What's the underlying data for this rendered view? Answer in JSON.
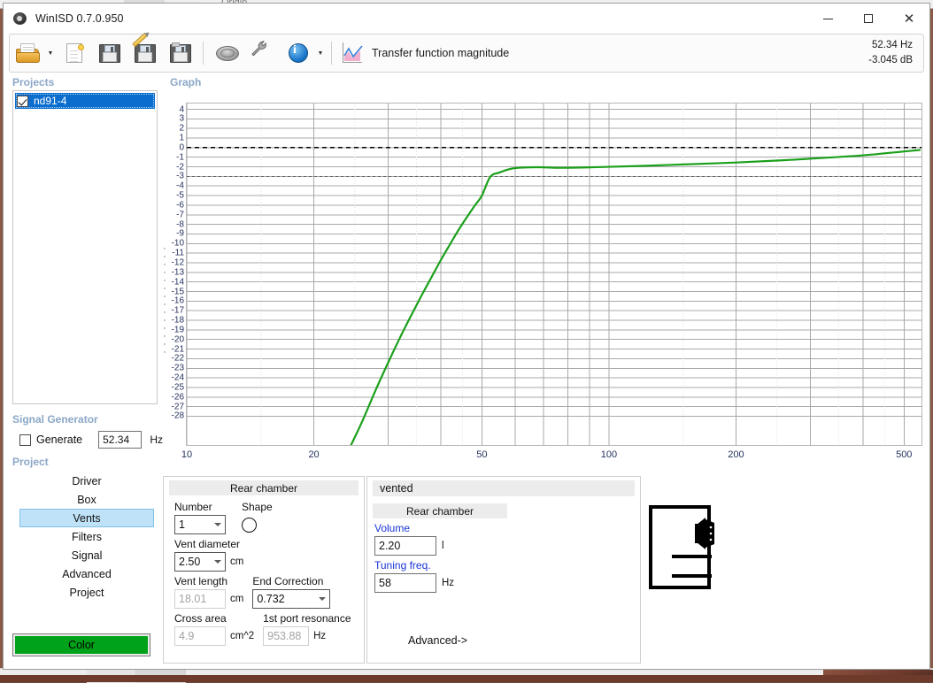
{
  "desktop": {
    "bg_window_label": "Origin"
  },
  "window": {
    "title": "WinISD 0.7.0.950",
    "icon": "speaker-icon",
    "minimize": "—",
    "maximize": "□",
    "close": "✕"
  },
  "toolbar": {
    "items": [
      {
        "name": "open-project-button",
        "icon": "open-folder-icon",
        "has_dropdown": true
      },
      {
        "name": "new-project-button",
        "icon": "new-document-icon",
        "has_dropdown": false
      },
      {
        "name": "save-button",
        "icon": "floppy-save-icon",
        "has_dropdown": false
      },
      {
        "name": "save-as-button",
        "icon": "floppy-pencil-icon",
        "has_dropdown": false
      },
      {
        "name": "save-all-button",
        "icon": "floppy-all-icon",
        "has_dropdown": false
      },
      {
        "name": "driver-database-button",
        "icon": "speaker-driver-icon",
        "has_dropdown": false
      },
      {
        "name": "tools-button",
        "icon": "wrench-icon",
        "has_dropdown": false
      },
      {
        "name": "info-button",
        "icon": "info-circle-icon",
        "has_dropdown": true
      }
    ],
    "graph_icon": "chart-curve-icon",
    "transfer_function_label": "Transfer function magnitude",
    "readout_frequency": "52.34 Hz",
    "readout_gain": "-3.045 dB"
  },
  "projects": {
    "caption": "Projects",
    "items": [
      {
        "label": "nd91-4",
        "checked": true,
        "selected": true
      }
    ]
  },
  "signal_generator": {
    "caption": "Signal Generator",
    "generate_label": "Generate",
    "generate_checked": false,
    "frequency_value": "52.34",
    "frequency_unit": "Hz"
  },
  "project_nav": {
    "caption": "Project",
    "items": [
      {
        "label": "Driver",
        "active": false
      },
      {
        "label": "Box",
        "active": false
      },
      {
        "label": "Vents",
        "active": true
      },
      {
        "label": "Filters",
        "active": false
      },
      {
        "label": "Signal",
        "active": false
      },
      {
        "label": "Advanced",
        "active": false
      },
      {
        "label": "Project",
        "active": false
      }
    ],
    "color_button_label": "Color",
    "color_button_color": "#00a21a"
  },
  "graph": {
    "caption": "Graph"
  },
  "chart_data": {
    "type": "line",
    "title": "Transfer function magnitude",
    "xlabel": "",
    "ylabel": "",
    "xscale": "log",
    "xlim": [
      10,
      550
    ],
    "ylim": [
      -31,
      4.6
    ],
    "xticks": [
      10,
      20,
      50,
      100,
      200,
      500
    ],
    "xtick_labels": [
      "10",
      "20",
      "50",
      "100",
      "200",
      "500"
    ],
    "yticks": [
      4,
      3,
      2,
      1,
      0,
      -1,
      -2,
      -3,
      -4,
      -5,
      -6,
      -7,
      -8,
      -9,
      -10,
      -11,
      -12,
      -13,
      -14,
      -15,
      -16,
      -17,
      -18,
      -19,
      -20,
      -21,
      -22,
      -23,
      -24,
      -25,
      -26,
      -27,
      -28
    ],
    "ytick_labels": [
      "4",
      "3",
      "2",
      "1",
      "0",
      "-1",
      "-2",
      "-3",
      "-4",
      "-5",
      "-6",
      "-7",
      "-8",
      "-9",
      "-10",
      "-11",
      "-12",
      "-13",
      "-14",
      "-15",
      "-16",
      "-17",
      "-18",
      "-19",
      "-20",
      "-21",
      "-22",
      "-23",
      "-24",
      "-25",
      "-26",
      "-27",
      "-28"
    ],
    "grid": true,
    "reference_lines": [
      {
        "y": 0,
        "style": "dashed",
        "color": "#000000",
        "width": 1.6
      },
      {
        "y": -3,
        "style": "dashed",
        "color": "#666666",
        "width": 1
      }
    ],
    "legend": "none",
    "series": [
      {
        "name": "nd91-4",
        "color": "#1ba01b",
        "x": [
          24.5,
          26,
          28,
          30,
          32,
          34,
          36,
          38,
          40,
          42,
          44,
          46,
          48,
          50,
          52.34,
          55,
          58,
          61,
          65,
          70,
          75,
          80,
          90,
          100,
          120,
          150,
          200,
          250,
          300,
          400,
          500,
          545
        ],
        "y": [
          -31.0,
          -28.6,
          -25.3,
          -22.4,
          -19.8,
          -17.5,
          -15.4,
          -13.5,
          -11.7,
          -10.1,
          -8.6,
          -7.3,
          -6.1,
          -5.0,
          -3.05,
          -2.6,
          -2.25,
          -2.1,
          -2.05,
          -2.05,
          -2.1,
          -2.1,
          -2.05,
          -2.0,
          -1.9,
          -1.75,
          -1.55,
          -1.35,
          -1.15,
          -0.8,
          -0.4,
          -0.25
        ]
      }
    ]
  },
  "vents_panel": {
    "caption": "Rear chamber",
    "number_label": "Number",
    "number_value": "1",
    "shape_label": "Shape",
    "shape_value": "circle",
    "vent_diameter_label": "Vent diameter",
    "vent_diameter_value": "2.50",
    "vent_diameter_unit": "cm",
    "vent_length_label": "Vent length",
    "vent_length_value": "18.01",
    "vent_length_unit": "cm",
    "end_correction_label": "End Correction",
    "end_correction_value": "0.732",
    "cross_area_label": "Cross area",
    "cross_area_value": "4.9",
    "cross_area_unit": "cm^2",
    "port_resonance_label": "1st port resonance",
    "port_resonance_value": "953.88",
    "port_resonance_unit": "Hz"
  },
  "box_panel": {
    "title": "vented",
    "caption": "Rear chamber",
    "volume_label": "Volume",
    "volume_value": "2.20",
    "volume_unit": "l",
    "tuning_label": "Tuning freq.",
    "tuning_value": "58",
    "tuning_unit": "Hz",
    "advanced_label": "Advanced->",
    "diagram": "vented-enclosure-icon"
  }
}
